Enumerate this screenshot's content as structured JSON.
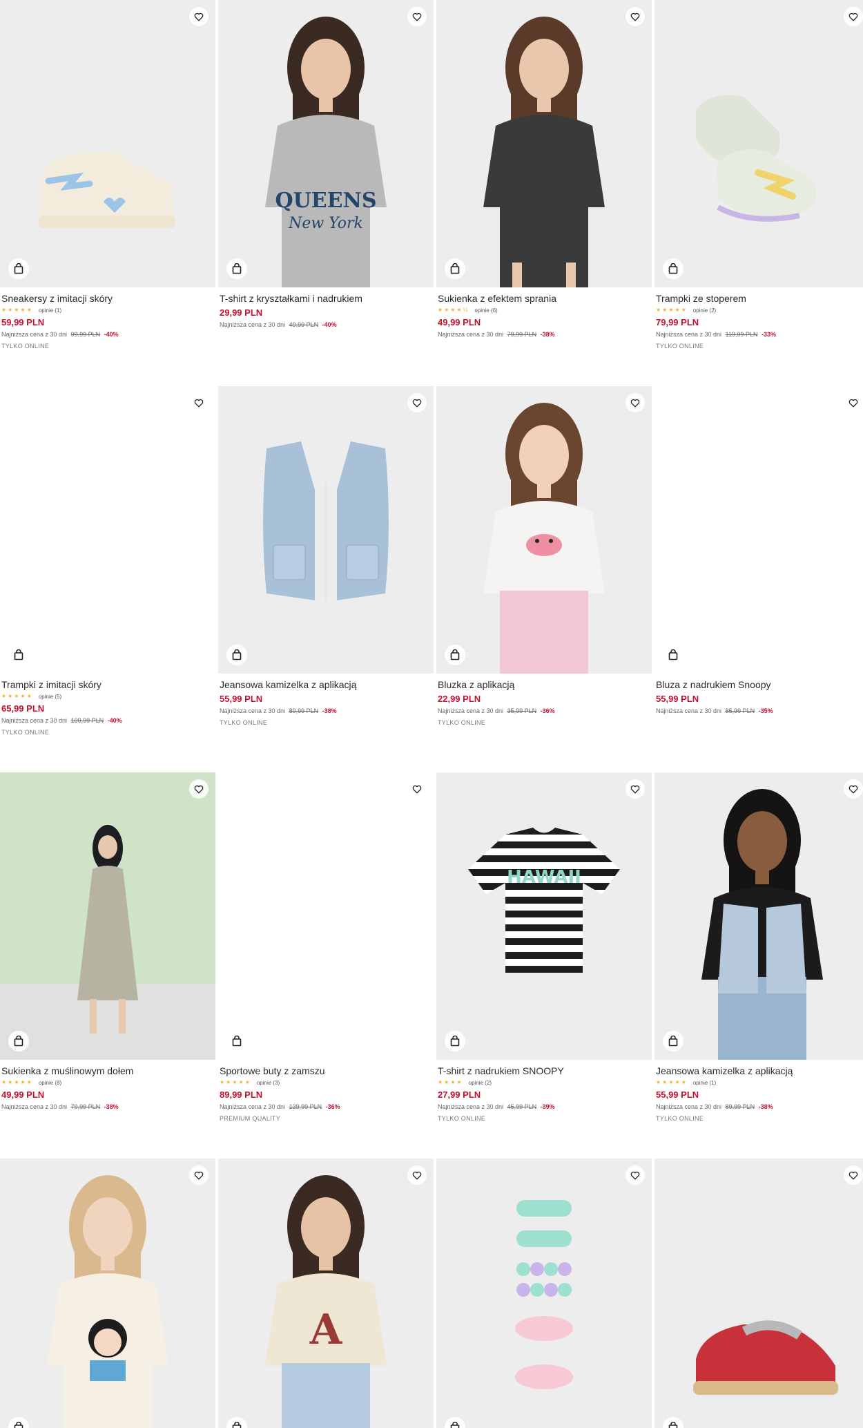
{
  "products": [
    {
      "name": "Sneakersy z imitacji skóry",
      "rating_value": 5,
      "stars": "★★★★★",
      "reviews": "opinie (1)",
      "price": "59,99 PLN",
      "lowest_label": "Najniższa cena z 30 dni",
      "old_price": "99,99 PLN",
      "discount": "-40%",
      "tag": "TYLKO ONLINE",
      "image": "sneaker-heart"
    },
    {
      "name": "T-shirt z kryształkami i nadrukiem",
      "rating_value": null,
      "stars": "",
      "reviews": "",
      "price": "29,99 PLN",
      "lowest_label": "Najniższa cena z 30 dni",
      "old_price": "49,99 PLN",
      "discount": "-40%",
      "tag": "",
      "image": "girl-queens-tshirt"
    },
    {
      "name": "Sukienka z efektem sprania",
      "rating_value": 4.5,
      "stars": "★★★★½",
      "reviews": "opinie (6)",
      "price": "49,99 PLN",
      "lowest_label": "Najniższa cena z 30 dni",
      "old_price": "79,99 PLN",
      "discount": "-38%",
      "tag": "",
      "image": "girl-grey-dress"
    },
    {
      "name": "Trampki ze stoperem",
      "rating_value": 5,
      "stars": "★★★★★",
      "reviews": "opinie (2)",
      "price": "79,99 PLN",
      "lowest_label": "Najniższa cena z 30 dni",
      "old_price": "119,99 PLN",
      "discount": "-33%",
      "tag": "TYLKO ONLINE",
      "image": "sneakers-mint"
    },
    {
      "name": "Trampki z imitacji skóry",
      "rating_value": 5,
      "stars": "★★★★★",
      "reviews": "opinie (5)",
      "price": "65,99 PLN",
      "lowest_label": "Najniższa cena z 30 dni",
      "old_price": "109,99 PLN",
      "discount": "-40%",
      "tag": "TYLKO ONLINE",
      "image": "blank"
    },
    {
      "name": "Jeansowa kamizelka z aplikacją",
      "rating_value": null,
      "stars": "",
      "reviews": "",
      "price": "55,99 PLN",
      "lowest_label": "Najniższa cena z 30 dni",
      "old_price": "89,99 PLN",
      "discount": "-38%",
      "tag": "TYLKO ONLINE",
      "image": "denim-vest"
    },
    {
      "name": "Bluzka z aplikacją",
      "rating_value": null,
      "stars": "",
      "reviews": "",
      "price": "22,99 PLN",
      "lowest_label": "Najniższa cena z 30 dni",
      "old_price": "35,99 PLN",
      "discount": "-36%",
      "tag": "TYLKO ONLINE",
      "image": "girl-crab-top"
    },
    {
      "name": "Bluza z nadrukiem Snoopy",
      "rating_value": null,
      "stars": "",
      "reviews": "",
      "price": "55,99 PLN",
      "lowest_label": "Najniższa cena z 30 dni",
      "old_price": "85,99 PLN",
      "discount": "-35%",
      "tag": "",
      "image": "blank"
    },
    {
      "name": "Sukienka z muślinowym dołem",
      "rating_value": 5,
      "stars": "★★★★★",
      "reviews": "opinie (8)",
      "price": "49,99 PLN",
      "lowest_label": "Najniższa cena z 30 dni",
      "old_price": "79,99 PLN",
      "discount": "-38%",
      "tag": "",
      "image": "girl-muslin-dress"
    },
    {
      "name": "Sportowe buty z zamszu",
      "rating_value": 5,
      "stars": "★★★★★",
      "reviews": "opinie (3)",
      "price": "89,99 PLN",
      "lowest_label": "Najniższa cena z 30 dni",
      "old_price": "139,99 PLN",
      "discount": "-36%",
      "tag": "PREMIUM QUALITY",
      "image": "blank"
    },
    {
      "name": "T-shirt z nadrukiem SNOOPY",
      "rating_value": 4,
      "stars": "★★★★",
      "reviews": "opinie (2)",
      "price": "27,99 PLN",
      "lowest_label": "Najniższa cena z 30 dni",
      "old_price": "45,99 PLN",
      "discount": "-39%",
      "tag": "TYLKO ONLINE",
      "image": "striped-tshirt"
    },
    {
      "name": "Jeansowa kamizelka z aplikacją",
      "rating_value": 5,
      "stars": "★★★★★",
      "reviews": "opinie (1)",
      "price": "55,99 PLN",
      "lowest_label": "Najniższa cena z 30 dni",
      "old_price": "89,99 PLN",
      "discount": "-38%",
      "tag": "TYLKO ONLINE",
      "image": "girl-denim-jacket"
    },
    {
      "name": "",
      "rating_value": null,
      "stars": "",
      "reviews": "",
      "price": "",
      "lowest_label": "",
      "old_price": "",
      "discount": "",
      "tag": "",
      "image": "girl-anime-tshirt"
    },
    {
      "name": "",
      "rating_value": null,
      "stars": "",
      "reviews": "",
      "price": "",
      "lowest_label": "",
      "old_price": "",
      "discount": "",
      "tag": "",
      "image": "girl-cream-tshirt"
    },
    {
      "name": "",
      "rating_value": null,
      "stars": "",
      "reviews": "",
      "price": "",
      "lowest_label": "",
      "old_price": "",
      "discount": "",
      "tag": "",
      "image": "hair-clips"
    },
    {
      "name": "",
      "rating_value": null,
      "stars": "",
      "reviews": "",
      "price": "",
      "lowest_label": "",
      "old_price": "",
      "discount": "",
      "tag": "",
      "image": "red-sneaker"
    }
  ],
  "icons": {
    "favorite": "heart-outline-icon",
    "cart": "shopping-bag-icon"
  },
  "colors": {
    "sale_price": "#c8102e",
    "star": "#f2b233",
    "text": "#2b2b2b"
  }
}
